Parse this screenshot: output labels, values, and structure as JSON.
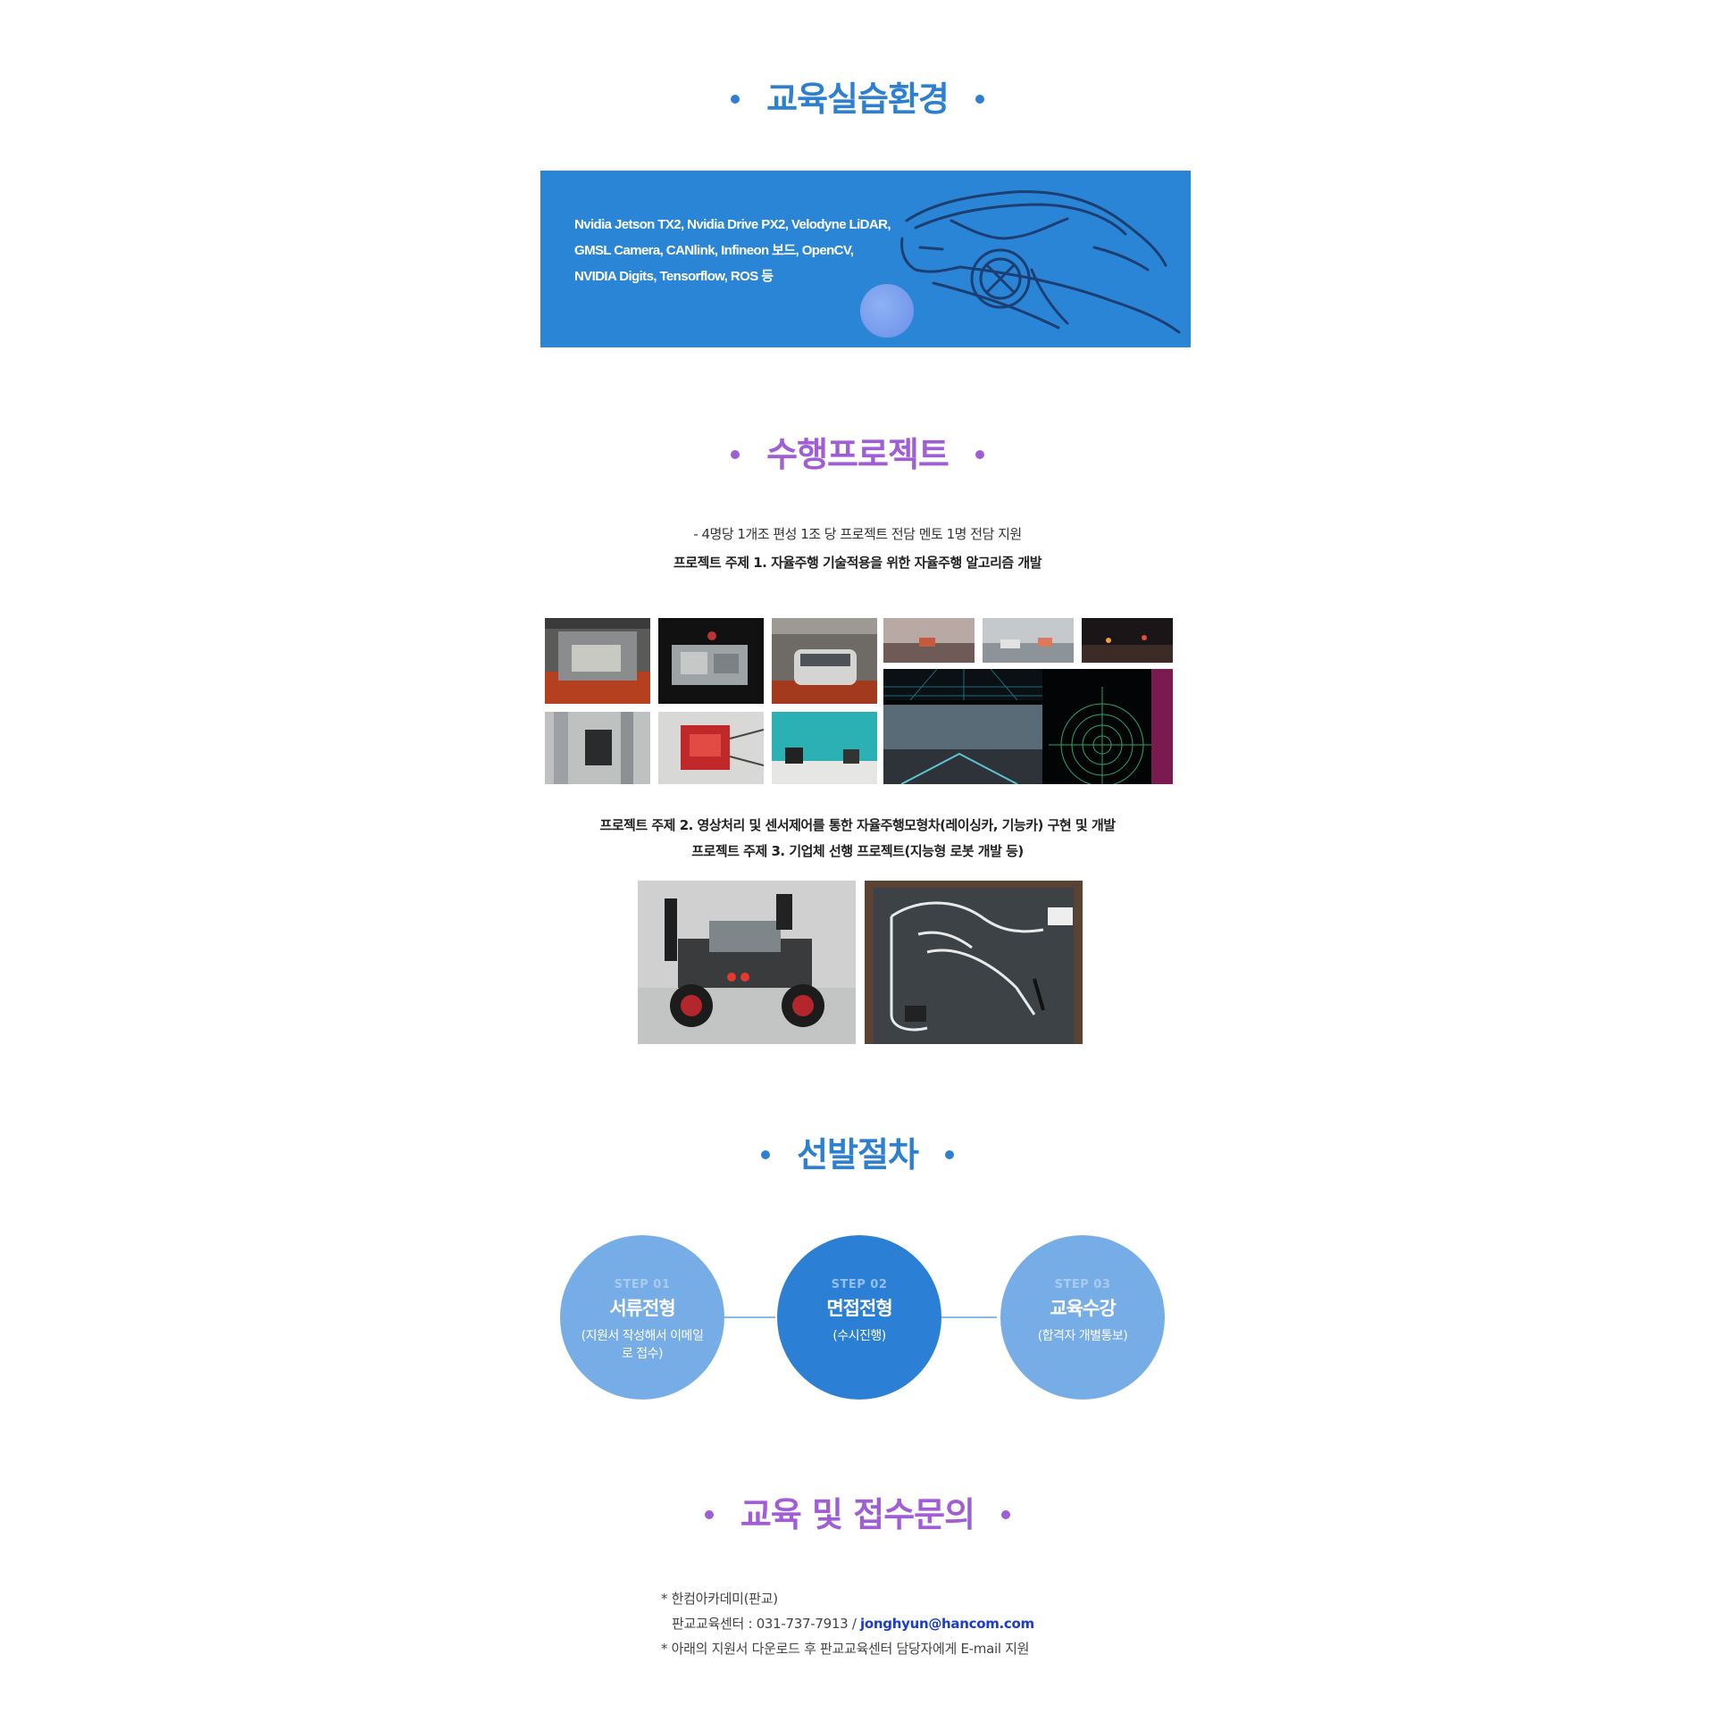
{
  "sections": {
    "environment": {
      "title": "교육실습환경"
    },
    "projects": {
      "title": "수행프로젝트"
    },
    "selection": {
      "title": "선발절차"
    },
    "contact": {
      "title": "교육 및 접수문의"
    }
  },
  "banner": {
    "lines": [
      "Nvidia Jetson TX2, Nvidia Drive PX2, Velodyne LiDAR,",
      "GMSL Camera, CANlink, Infineon 보드, OpenCV,",
      "NVIDIA Digits, Tensorflow, ROS 등"
    ]
  },
  "projects": {
    "intro": "- 4명당 1개조 편성 1조 당 프로젝트 전담 멘토 1명 전담 지원",
    "topic1": "프로젝트 주제 1. 자율주행 기술적용을 위한 자율주행 알고리즘 개발",
    "topic2": "프로젝트 주제 2. 영상처리 및 센서제어를 통한 자율주행모형차(레이싱카, 기능카) 구현 및 개발",
    "topic3": "프로젝트 주제 3. 기업체 선행 프로젝트(지능형 로봇 개발 등)"
  },
  "steps": [
    {
      "num": "STEP 01",
      "name": "서류전형",
      "desc": "(지원서 작성해서 이메일로 접수)"
    },
    {
      "num": "STEP 02",
      "name": "면접전형",
      "desc": "(수시진행)"
    },
    {
      "num": "STEP 03",
      "name": "교육수강",
      "desc": "(합격자 개별통보)"
    }
  ],
  "contact": {
    "line1": "* 한컴아카데미(판교)",
    "line2_prefix": "판교교육센터 : 031-737-7913 / ",
    "email": "jonghyun@hancom.com",
    "line3": "* 아래의 지원서 다운로드 후 판교교육센터 담당자에게 E-mail 지원"
  },
  "colors": {
    "accent_blue": "#2d80d1",
    "accent_purple": "#a05ed6",
    "banner_bg": "#2b85d6",
    "step_light": "#77ade6",
    "step_dark": "#2b7fd4",
    "email_link": "#1a3ccf"
  }
}
